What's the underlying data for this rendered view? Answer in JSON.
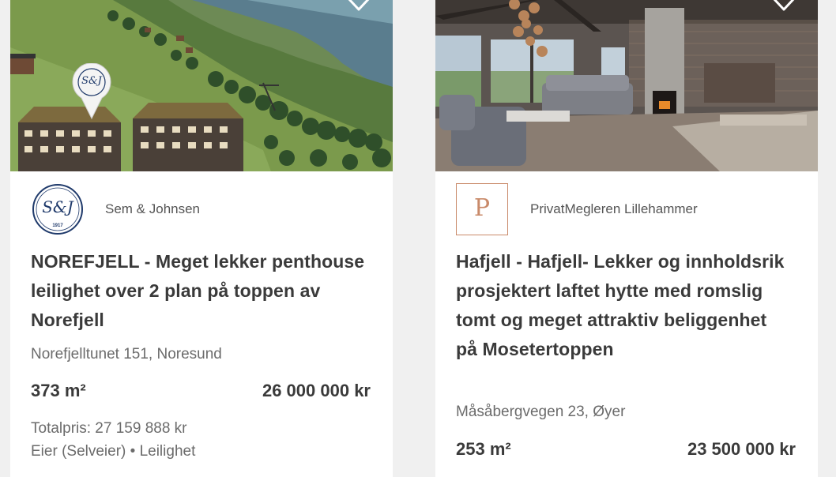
{
  "listings": [
    {
      "agency": "Sem & Johnsen",
      "agency_logo_text": "S&J",
      "agency_logo_year": "1917",
      "title": "NOREFJELL - Meget lekker penthouse leilighet over 2 plan på toppen av Norefjell",
      "address": "Norefjelltunet 151, Noresund",
      "size": "373 m²",
      "price": "26 000 000 kr",
      "total_price": "Totalpris: 27 159 888 kr",
      "ownership": "Eier (Selveier) • Leilighet",
      "map_pin_text": "S&J"
    },
    {
      "agency": "PrivatMegleren Lillehammer",
      "agency_logo_text": "P",
      "title": "Hafjell - Hafjell- Lekker og innholdsrik prosjektert laftet hytte med romslig tomt og meget attraktiv beliggenhet på Mosetertoppen",
      "address": "Måsåbergvegen 23, Øyer",
      "size": "253 m²",
      "price": "23 500 000 kr"
    }
  ],
  "colors": {
    "privatmegleren_accent": "#c98a6a",
    "sem_johnsen_navy": "#1f3a6b"
  }
}
